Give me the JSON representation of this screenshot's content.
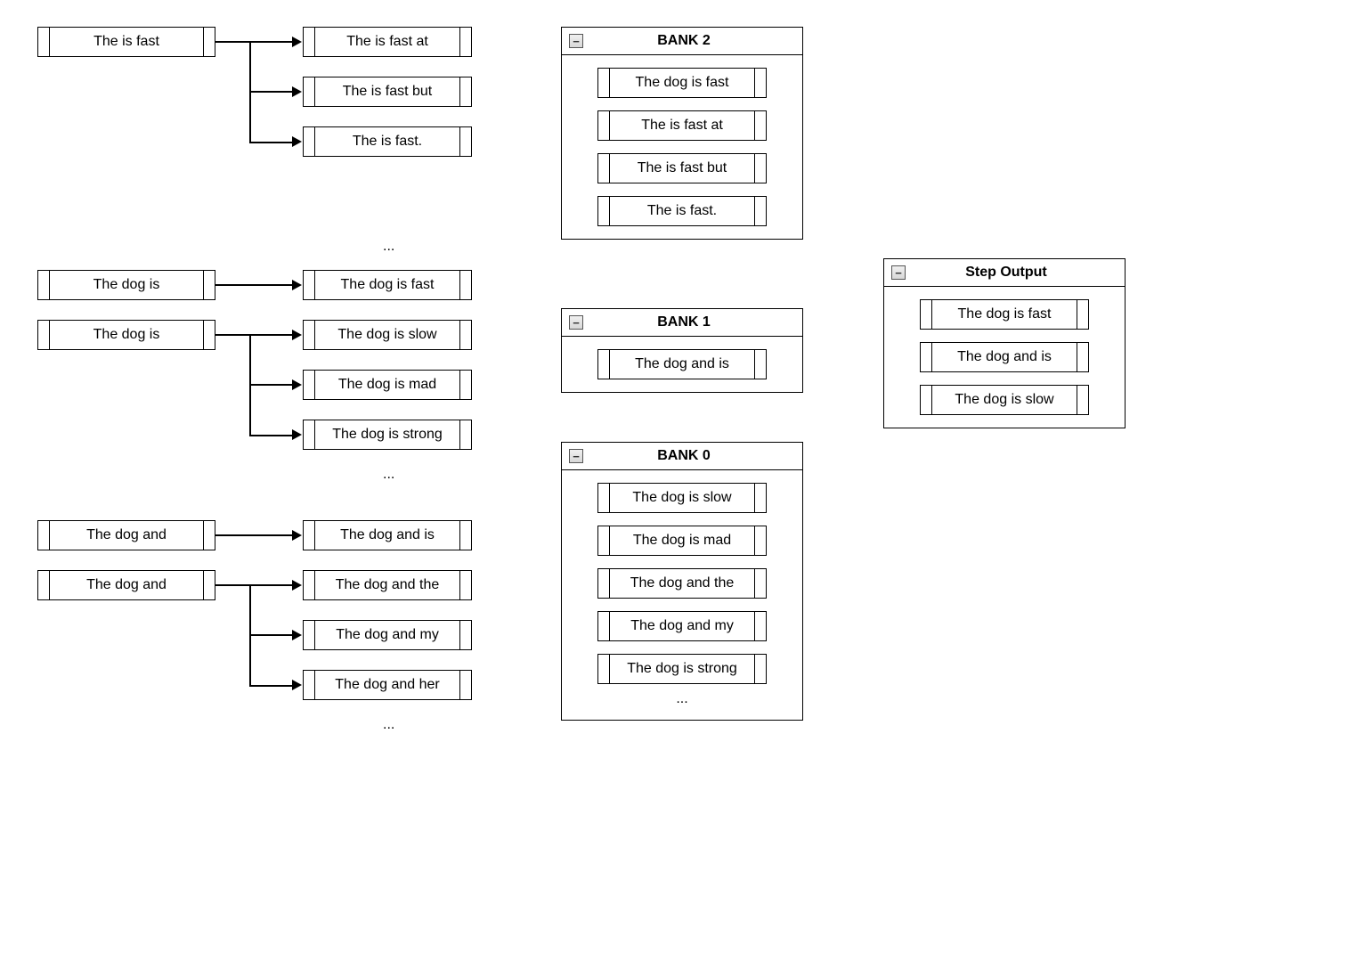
{
  "left_column": {
    "group1": {
      "source": "The is fast",
      "targets": [
        "The is fast at",
        "The is fast but",
        "The is fast."
      ],
      "ellipsis_after": "..."
    },
    "group2": {
      "source1": "The dog is",
      "source1_target": "The dog is fast",
      "source2": "The dog is",
      "source2_targets": [
        "The dog is slow",
        "The dog is mad",
        "The dog is strong"
      ],
      "ellipsis_after": "..."
    },
    "group3": {
      "source1": "The dog and",
      "source1_target": "The dog and is",
      "source2": "The dog and",
      "source2_targets": [
        "The dog and the",
        "The dog and my",
        "The dog and her"
      ],
      "ellipsis_after": "..."
    }
  },
  "banks": {
    "bank2": {
      "title": "BANK 2",
      "items": [
        "The dog is fast",
        "The is fast at",
        "The is fast but",
        "The is fast."
      ]
    },
    "bank1": {
      "title": "BANK 1",
      "items": [
        "The dog and is"
      ]
    },
    "bank0": {
      "title": "BANK 0",
      "items": [
        "The dog is slow",
        "The dog is mad",
        "The dog and the",
        "The dog and my",
        "The dog is strong"
      ],
      "ellipsis": "..."
    }
  },
  "output": {
    "title": "Step Output",
    "items": [
      "The dog is fast",
      "The dog and is",
      "The dog is slow"
    ]
  },
  "collapse_glyph": "−"
}
